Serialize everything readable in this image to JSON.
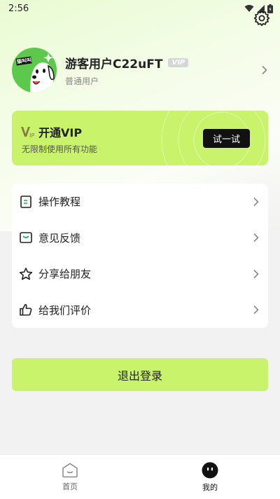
{
  "status_bar": {
    "time": "2:56"
  },
  "icons": {
    "settings": "gear-icon",
    "wifi": "wifi-icon",
    "signal": "signal-icon",
    "battery": "battery-icon",
    "chevron": "chevron-right-icon"
  },
  "profile": {
    "avatar_badge": "猫叫叫",
    "name": "游客用户C22uFT",
    "vip_badge": "VIP",
    "user_type": "普通用户"
  },
  "vip_card": {
    "title": "开通VIP",
    "description": "无限制使用所有功能",
    "button_label": "试一试"
  },
  "menu": {
    "items": [
      {
        "label": "操作教程",
        "icon": "document-icon"
      },
      {
        "label": "意见反馈",
        "icon": "message-icon"
      },
      {
        "label": "分享给朋友",
        "icon": "star-icon"
      },
      {
        "label": "给我们评价",
        "icon": "thumbs-up-icon"
      }
    ]
  },
  "logout": {
    "label": "退出登录"
  },
  "tab_bar": {
    "tabs": [
      {
        "label": "首页",
        "active": false
      },
      {
        "label": "我的",
        "active": true
      }
    ]
  },
  "colors": {
    "accent": "#c9f36a",
    "avatar_bg": "#5cc84c",
    "background": "#f2f2f2"
  }
}
